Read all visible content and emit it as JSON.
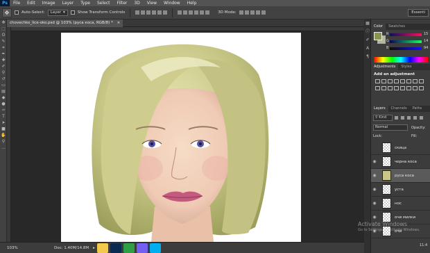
{
  "app": {
    "logo": "Ps"
  },
  "menu": [
    "File",
    "Edit",
    "Image",
    "Layer",
    "Type",
    "Select",
    "Filter",
    "3D",
    "View",
    "Window",
    "Help"
  ],
  "options": {
    "auto_select": "Auto-Select:",
    "target": "Layer",
    "transform": "Show Transform Controls",
    "mode_3d": "3D Mode:",
    "workspace": "Essenti"
  },
  "document": {
    "tab_title": "chovechko_lice-oko.psd @ 103% (руса коса, RGB/8) *"
  },
  "status": {
    "zoom": "103%",
    "doc_info": "Doc: 1.40M/14.8M"
  },
  "color_panel": {
    "tabs": [
      "Color",
      "Swatches"
    ],
    "channels": [
      {
        "letter": "R",
        "value": "15"
      },
      {
        "letter": "G",
        "value": "14"
      },
      {
        "letter": "B",
        "value": "94"
      }
    ],
    "foreground": "#8b9351",
    "background": "#b5b89a"
  },
  "adjustments_panel": {
    "tabs": [
      "Adjustments",
      "Styles"
    ],
    "title": "Add an adjustment"
  },
  "layers_panel": {
    "tabs": [
      "Layers",
      "Channels",
      "Paths"
    ],
    "filter_kind": "Kind",
    "blend_mode": "Normal",
    "opacity_label": "Opacity:",
    "lock_label": "Lock:",
    "fill_label": "Fill:",
    "layers": [
      {
        "name": "скица",
        "selected": false
      },
      {
        "name": "черна коса",
        "selected": false
      },
      {
        "name": "руса коса",
        "selected": true
      },
      {
        "name": "уста",
        "selected": false
      },
      {
        "name": "нос",
        "selected": false
      },
      {
        "name": "очи милки",
        "selected": false
      },
      {
        "name": "очи",
        "selected": false
      }
    ]
  },
  "watermark": {
    "line1": "Activate Windows",
    "line2": "Go to Settings to activate Windows."
  },
  "clock": "11:4"
}
